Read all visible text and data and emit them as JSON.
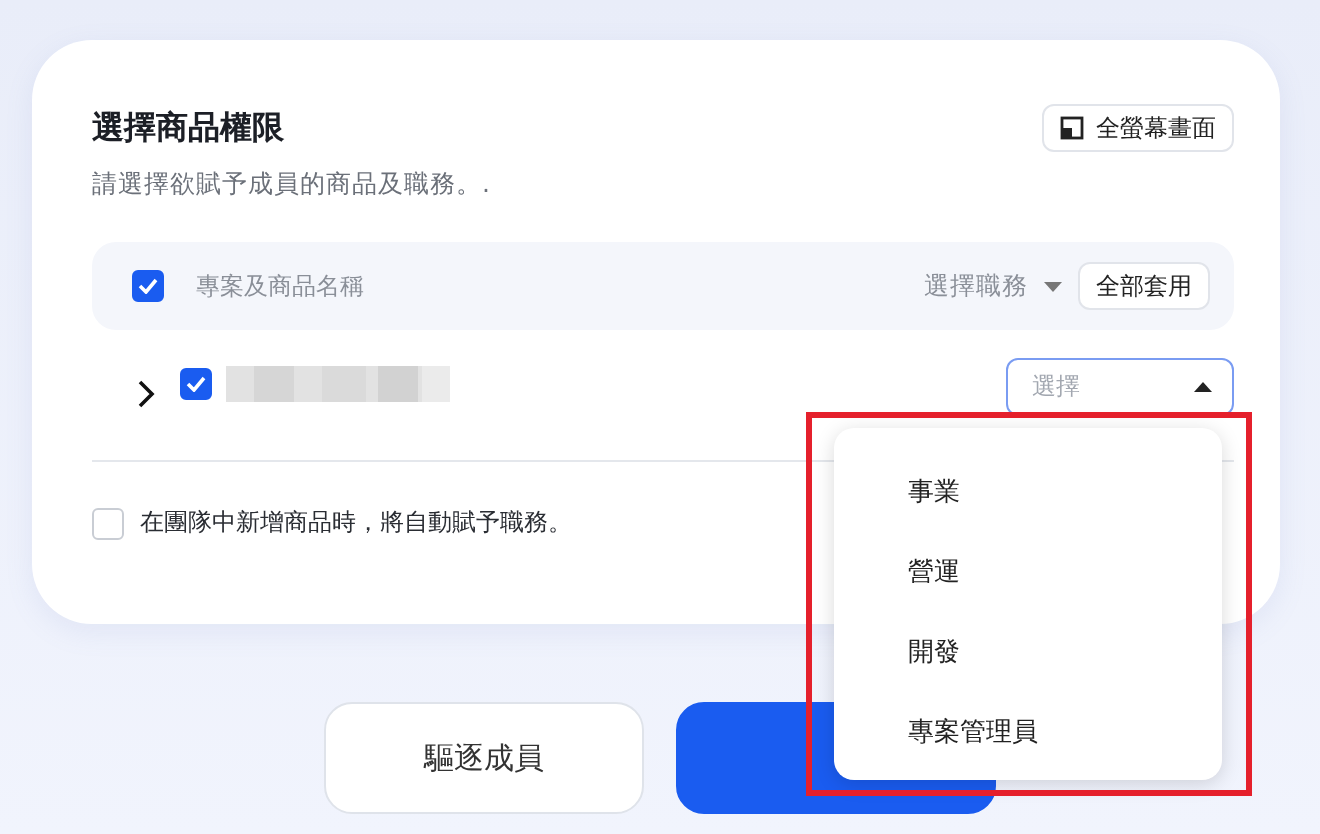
{
  "card": {
    "title": "選擇商品權限",
    "fullscreen_button": "全螢幕畫面",
    "subtitle": "請選擇欲賦予成員的商品及職務。.",
    "header_row": {
      "checked": true,
      "label": "專案及商品名稱",
      "role_select": "選擇職務",
      "apply_all_button": "全部套用"
    },
    "product_row": {
      "expanded": false,
      "checked": true,
      "select": {
        "placeholder": "選擇",
        "open": true
      }
    },
    "auto_assign": {
      "checked": false,
      "label": "在團隊中新增商品時，將自動賦予職務。"
    }
  },
  "dropdown": {
    "options": [
      {
        "label": "事業"
      },
      {
        "label": "營運"
      },
      {
        "label": "開發"
      },
      {
        "label": "專案管理員"
      }
    ]
  },
  "buttons": [
    {
      "kind": "secondary",
      "label": "驅逐成員"
    },
    {
      "kind": "primary"
    }
  ]
}
